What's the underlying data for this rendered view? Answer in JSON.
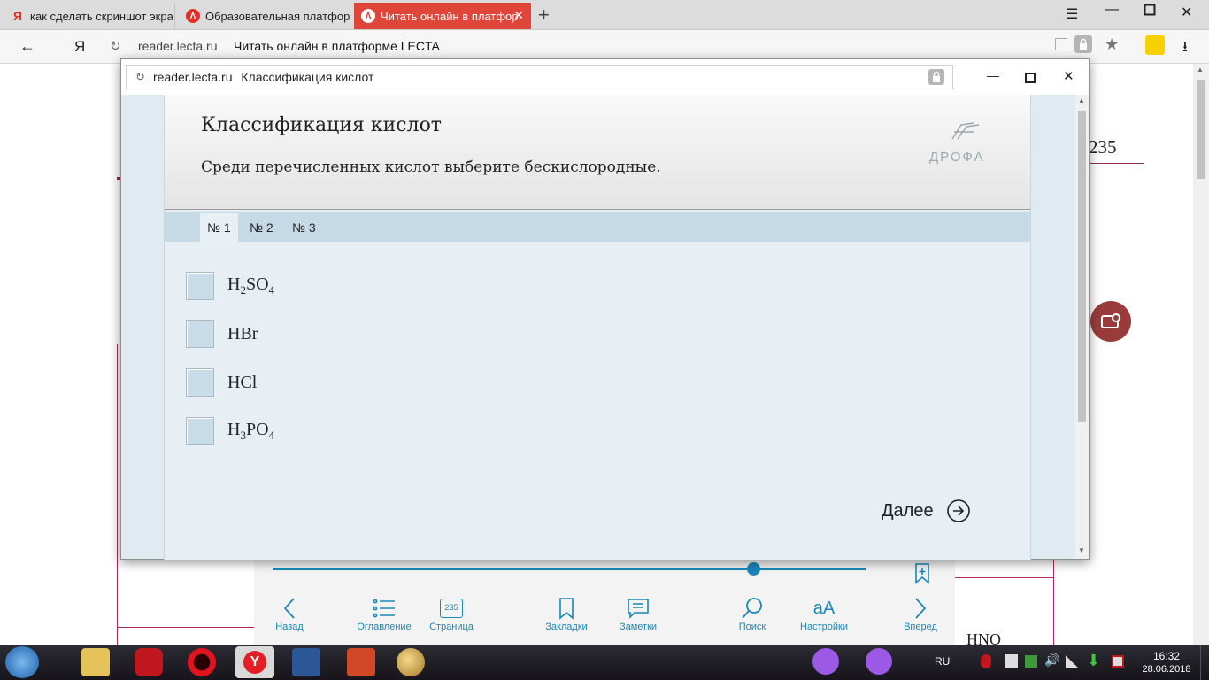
{
  "browser": {
    "tabs": [
      {
        "label": "как сделать скриншот экра",
        "favicon": "Я"
      },
      {
        "label": "Образовательная платфор",
        "favicon": "Λ"
      },
      {
        "label": "Читать онлайн в платфор",
        "favicon": "Λ"
      }
    ],
    "new_tab": "+",
    "back": "←",
    "yandex_logo": "Я",
    "url_domain": "reader.lecta.ru",
    "url_title": "Читать онлайн в платформе LECTA"
  },
  "book": {
    "page_number": "235",
    "bottom_fragment": "HNO"
  },
  "popup": {
    "url_domain": "reader.lecta.ru",
    "url_title": "Классификация кислот",
    "title": "Классификация кислот",
    "instruction": "Среди перечисленных кислот выберите бескислородные.",
    "publisher": "ДРОФА",
    "tabs": [
      "№ 1",
      "№ 2",
      "№ 3"
    ],
    "options": [
      {
        "parts": [
          "H",
          "2",
          "SO",
          "4"
        ]
      },
      {
        "parts": [
          "HBr"
        ]
      },
      {
        "parts": [
          "HCl"
        ]
      },
      {
        "parts": [
          "H",
          "3",
          "PO",
          "4"
        ]
      }
    ],
    "next_label": "Далее"
  },
  "toolbar": {
    "progress": 0.81,
    "items": [
      {
        "label": "Назад",
        "icon": "chevron-left-icon"
      },
      {
        "label": "Оглавление",
        "icon": "list-icon"
      },
      {
        "label": "Страница",
        "icon": "page-icon",
        "badge": "235"
      },
      {
        "label": "Закладки",
        "icon": "bookmark-icon"
      },
      {
        "label": "Заметки",
        "icon": "note-icon"
      },
      {
        "label": "Поиск",
        "icon": "search-icon"
      },
      {
        "label": "Настройки",
        "icon": "font-settings-icon",
        "glyph": "aA"
      },
      {
        "label": "Вперед",
        "icon": "chevron-right-icon"
      }
    ]
  },
  "taskbar": {
    "lang": "RU",
    "time": "16:32",
    "date": "28.06.2018"
  },
  "colors": {
    "accent": "#1a87b8",
    "tab_active": "#e0453a"
  }
}
